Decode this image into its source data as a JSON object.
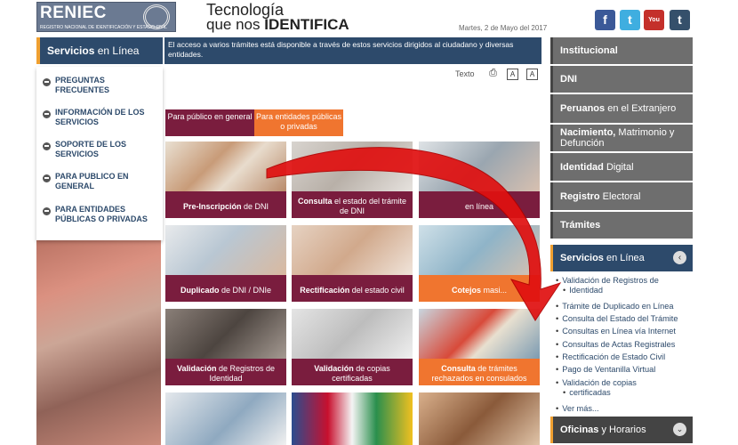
{
  "header": {
    "logo_text": "RENIEC",
    "logo_sub": "REGISTRO NACIONAL DE IDENTIFICACIÓN Y ESTADO CIVIL",
    "slogan_line1": "Tecnología",
    "slogan_line2a": "que nos ",
    "slogan_line2b": "IDENTIFICA",
    "date": "Martes, 2 de Mayo del 2017",
    "social": {
      "facebook": "f",
      "twitter": "t",
      "youtube": "You Tube",
      "tumblr": "t"
    }
  },
  "left": {
    "section_title_bold": "Servicios",
    "section_title_rest": " en Línea",
    "menu": [
      "PREGUNTAS FRECUENTES",
      "INFORMACIÓN DE LOS SERVICIOS",
      "SOPORTE DE LOS SERVICIOS",
      "PARA PUBLICO EN GENERAL",
      "PARA ENTIDADES PÚBLICAS O PRIVADAS"
    ]
  },
  "info_text": "El acceso a varios trámites está disponible a través de estos servicios dirigidos al ciudadano y diversas entidades.",
  "tools": {
    "text_label": "Texto",
    "print": "⎙",
    "a_plus": "A",
    "a_minus": "A"
  },
  "tabs": [
    "Para público en general",
    "Para entidades públicas o privadas"
  ],
  "tiles": [
    {
      "bold": "Pre-Inscripción",
      "rest": " de DNI",
      "style": "m"
    },
    {
      "bold": "Consulta",
      "rest": " el estado del trámite de DNI",
      "style": "m"
    },
    {
      "bold": "",
      "rest": "en línea",
      "style": "m"
    },
    {
      "bold": "Duplicado",
      "rest": " de DNI / DNIe",
      "style": "m"
    },
    {
      "bold": "Rectificación",
      "rest": " del estado civil",
      "style": "m"
    },
    {
      "bold": "Cotejos",
      "rest": " masi...",
      "style": "o"
    },
    {
      "bold": "Validación",
      "rest": " de Registros de Identidad",
      "style": "m"
    },
    {
      "bold": "Validación",
      "rest": " de copias certificadas",
      "style": "m"
    },
    {
      "bold": "Consulta",
      "rest": " de trámites rechazados en consulados",
      "style": "o"
    }
  ],
  "right": {
    "menu": [
      {
        "bold": "Institucional",
        "rest": ""
      },
      {
        "bold": "DNI",
        "rest": ""
      },
      {
        "bold": "Peruanos",
        "rest": " en el Extranjero"
      },
      {
        "bold": "Nacimiento,",
        "rest": " Matrimonio y Defunción"
      },
      {
        "bold": "Identidad",
        "rest": " Digital"
      },
      {
        "bold": "Registro",
        "rest": " Electoral"
      },
      {
        "bold": "Trámites",
        "rest": ""
      }
    ],
    "services_bold": "Servicios",
    "services_rest": " en Línea",
    "services_chevron": "‹",
    "services_list": [
      "Validación de Registros de",
      "Identidad",
      "Trámite de Duplicado en Línea",
      "Consulta del Estado del Trámite",
      "Consultas en Línea vía Internet",
      "Consultas de Actas Registrales",
      "Rectificación de Estado Civil",
      "Pago de Ventanilla Virtual",
      "Validación de copias",
      "certificadas",
      "Ver más..."
    ],
    "hours_bold": "Oficinas",
    "hours_rest": " y Horarios",
    "hours_chevron": "⌄"
  },
  "colors": {
    "navy": "#2d4a6b",
    "maroon": "#7a1d3e",
    "orange": "#f0752f",
    "gray": "#6e6e6e",
    "arrow_red": "#e01010"
  }
}
